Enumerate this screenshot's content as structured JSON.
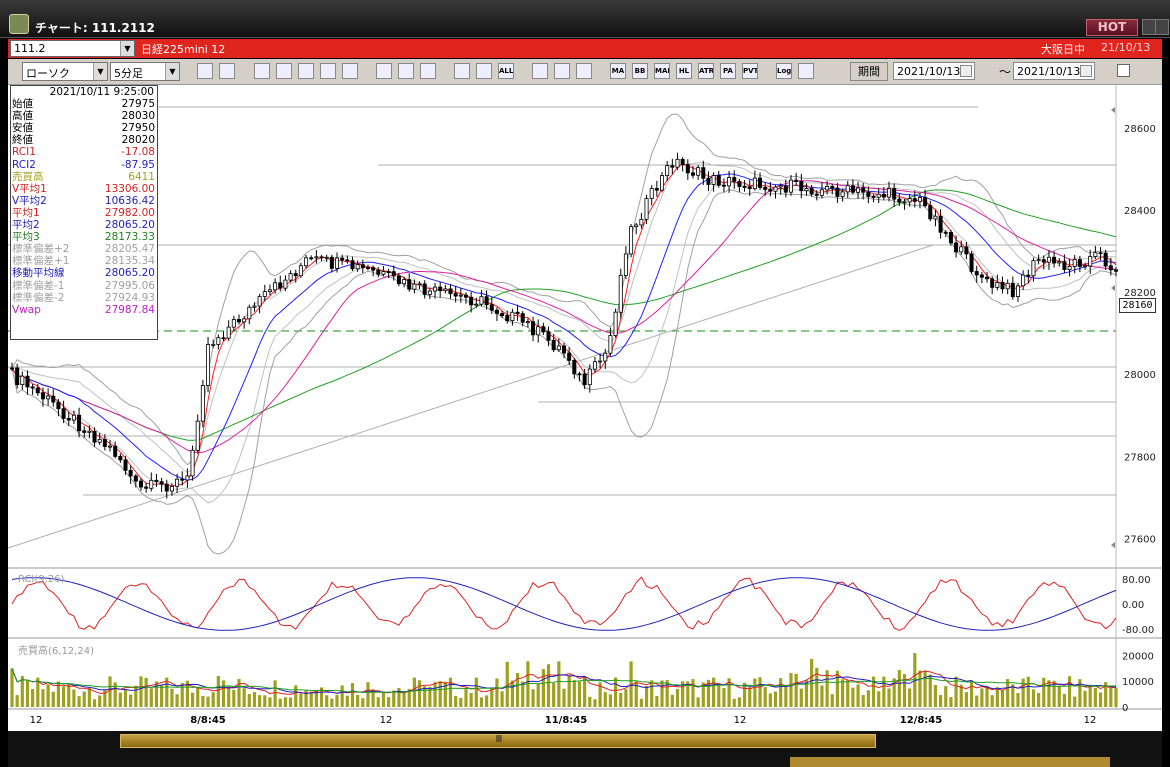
{
  "window": {
    "title": "チャート: 111.2112",
    "hot_label": "HOT"
  },
  "infobar": {
    "symbol_code": "111.2",
    "instrument": "日経225mini 12",
    "session": "大阪日中",
    "date": "21/10/13"
  },
  "toolbar": {
    "chart_type": "ローソク",
    "interval": "5分足",
    "period_label": "期間",
    "date_from": "2021/10/13",
    "date_to": "2021/10/13",
    "tilde": "～",
    "icons": [
      "search-icon",
      "crosshair-icon",
      "arrow-down-icon",
      "zoom-icon",
      "bar-icon",
      "scale-icon",
      "blank-icon",
      "pencil-icon",
      "cursor-icon",
      "undo-icon",
      "candle-icon",
      "candle-icon",
      "all-icon",
      "grid-icon",
      "brush-icon",
      "palette-icon",
      "ma-icon",
      "bb-icon",
      "mae-icon",
      "hl-icon",
      "atr-icon",
      "para-icon",
      "pvt-icon",
      "log-icon",
      "print-icon"
    ],
    "icon_labels": [
      "",
      "",
      "",
      "",
      "",
      "",
      "",
      "",
      "",
      "",
      "",
      "",
      "ALL",
      "",
      "",
      "",
      "MA",
      "BB",
      "MAE",
      "HL",
      "ATR",
      "PA RA",
      "PVT",
      "Log",
      ""
    ]
  },
  "data_panel": {
    "timestamp": "2021/10/11 9:25:00",
    "rows": [
      {
        "label": "始値",
        "value": "27975",
        "color": "#000000"
      },
      {
        "label": "高値",
        "value": "28030",
        "color": "#000000"
      },
      {
        "label": "安値",
        "value": "27950",
        "color": "#000000"
      },
      {
        "label": "終値",
        "value": "28020",
        "color": "#000000"
      },
      {
        "label": "RCI1",
        "value": "-17.08",
        "color": "#d02020"
      },
      {
        "label": "RCI2",
        "value": "-87.95",
        "color": "#2020c0"
      },
      {
        "label": "売買高",
        "value": "6411",
        "color": "#a0a020"
      },
      {
        "label": "V平均1",
        "value": "13306.00",
        "color": "#d02020"
      },
      {
        "label": "V平均2",
        "value": "10636.42",
        "color": "#2020c0"
      },
      {
        "label": "平均1",
        "value": "27982.00",
        "color": "#d02020"
      },
      {
        "label": "平均2",
        "value": "28065.20",
        "color": "#2020c0"
      },
      {
        "label": "平均3",
        "value": "28173.33",
        "color": "#208020"
      },
      {
        "label": "標準偏差+2",
        "value": "28205.47",
        "color": "#a0a0a0"
      },
      {
        "label": "標準偏差+1",
        "value": "28135.34",
        "color": "#a0a0a0"
      },
      {
        "label": "移動平均線",
        "value": "28065.20",
        "color": "#2020c0"
      },
      {
        "label": "標準偏差-1",
        "value": "27995.06",
        "color": "#a0a0a0"
      },
      {
        "label": "標準偏差-2",
        "value": "27924.93",
        "color": "#a0a0a0"
      },
      {
        "label": "Vwap",
        "value": "27987.84",
        "color": "#c020c0"
      }
    ]
  },
  "price_axis": {
    "ticks": [
      "28600",
      "28400",
      "28200",
      "28000",
      "27800",
      "27600"
    ],
    "current_price": "28160"
  },
  "rci_panel": {
    "label": "RCI(9,26)",
    "ticks": [
      "80.00",
      "0.00",
      "-80.00"
    ]
  },
  "volume_panel": {
    "label": "売買高(6,12,24)",
    "ticks": [
      "20000",
      "10000",
      "0"
    ]
  },
  "time_axis": {
    "labels": [
      "12",
      "8/8:45",
      "12",
      "11/8:45",
      "12",
      "12/8:45",
      "12"
    ]
  },
  "colors": {
    "red_bar": "#e0241e",
    "ma1": "#ff2020",
    "ma2": "#2020ff",
    "ma3": "#20a020",
    "vwap": "#e020a0",
    "volume": "#a0a020"
  }
}
